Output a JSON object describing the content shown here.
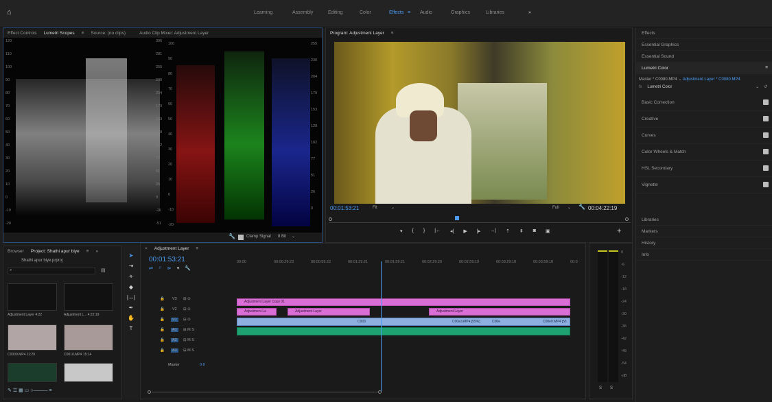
{
  "workspaces": [
    "Learning",
    "Assembly",
    "Editing",
    "Color",
    "Effects",
    "Audio",
    "Graphics",
    "Libraries"
  ],
  "active_workspace": "Effects",
  "scopes_panel": {
    "tabs": [
      "Effect Controls",
      "Lumetri Scopes",
      "Source: (no clips)",
      "Audio Clip Mixer: Adjustment Layer"
    ],
    "waveform_ticks": [
      "120",
      "110",
      "100",
      "90",
      "80",
      "70",
      "60",
      "50",
      "40",
      "30",
      "20",
      "10",
      "0",
      "-10",
      "-20"
    ],
    "parade_left_ticks": [
      "306",
      "281",
      "255",
      "230",
      "204",
      "179",
      "153",
      "128",
      "102",
      "77",
      "51",
      "26",
      "0",
      "-26",
      "-51"
    ],
    "parade_left_ire": [
      "100",
      "90",
      "80",
      "70",
      "60",
      "50",
      "40",
      "30",
      "20",
      "10",
      "0",
      "-10",
      "-20"
    ],
    "parade_right_ticks": [
      "255",
      "230",
      "204",
      "179",
      "153",
      "128",
      "102",
      "77",
      "51",
      "26",
      "0"
    ],
    "clamp_signal": "Clamp Signal",
    "bit_depth": "8 Bit"
  },
  "program_monitor": {
    "title": "Program: Adjustment Layer",
    "timecode": "00:01:53:21",
    "fit": "Fit",
    "quality": "Full",
    "duration": "00:04:22:19"
  },
  "right_panel": {
    "items": [
      "Effects",
      "Essential Graphics",
      "Essential Sound",
      "Lumetri Color"
    ],
    "master": "Master * C0080.MP4",
    "adjustment": "Adjustment Layer * C0080.MP4",
    "fx_name": "Lumetri Color",
    "sections": [
      "Basic Correction",
      "Creative",
      "Curves",
      "Color Wheels & Match",
      "HSL Secondary",
      "Vignette"
    ],
    "bottom_items": [
      "Libraries",
      "Markers",
      "History",
      "Info"
    ]
  },
  "project_panel": {
    "tabs": [
      "Browser",
      "Project: Shathi apur biye"
    ],
    "file": "Shathi apur biye.prproj",
    "items": [
      {
        "name": "Adjustment Layer",
        "dur": "4:22"
      },
      {
        "name": "Adjustment L...",
        "dur": "4:22:19"
      },
      {
        "name": "C0009.MP4",
        "dur": "11:29"
      },
      {
        "name": "C0010.MP4",
        "dur": "15:14"
      }
    ]
  },
  "timeline": {
    "title": "Adjustment Layer",
    "timecode": "00:01:53:21",
    "ruler": [
      "00:00",
      "00:00:29:23",
      "00:00:59:22",
      "00:01:29:21",
      "00:01:59:21",
      "00:02:29:20",
      "00:02:59:19",
      "00:03:29:18",
      "00:03:59:18",
      "00:0"
    ],
    "tracks": [
      "V3",
      "V2",
      "V1",
      "A1",
      "A2",
      "A3"
    ],
    "master_label": "Master",
    "master_value": "0.0",
    "clips": {
      "v3": "Adjustment Layer Copy 01",
      "v2a": "Adjustment La",
      "v2b": "Adjustment Layer",
      "v2c": "Adjustment Layer",
      "v1a": "C003",
      "v1b": "C00e3.MP4 [55%]",
      "v1c": "C00e",
      "v1d": "C00e0.MP4 [55"
    }
  },
  "meters": {
    "ticks": [
      "0",
      "-6",
      "-12",
      "-18",
      "-24",
      "-30",
      "-36",
      "-42",
      "-48",
      "-54",
      "-dB"
    ],
    "solo": [
      "S",
      "S"
    ]
  }
}
